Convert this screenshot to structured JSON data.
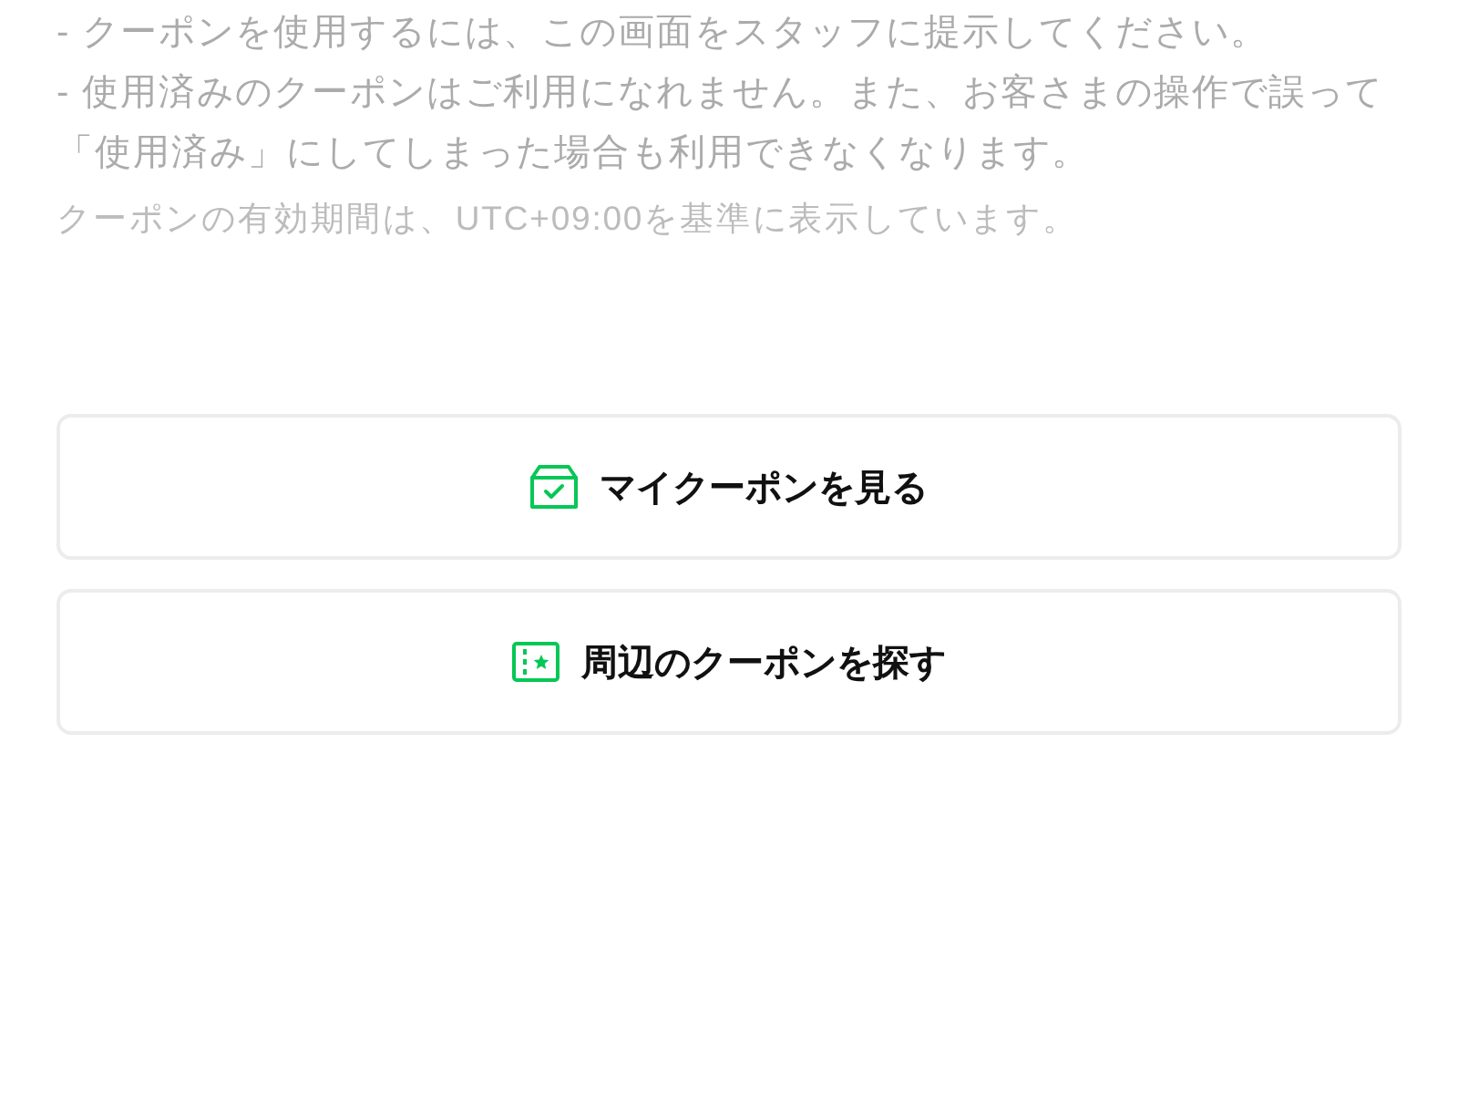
{
  "notes": [
    "- クーポンを使用するには、この画面をスタッフに提示してください。",
    "- 使用済みのクーポンはご利用になれません。また、お客さまの操作で誤って「使用済み」にしてしまった場合も利用できなくなります。"
  ],
  "timezone_note": "クーポンの有効期間は、UTC+09:00を基準に表示しています。",
  "buttons": [
    {
      "label": "マイクーポンを見る",
      "kind": "my_coupons"
    },
    {
      "label": "周辺のクーポンを探す",
      "kind": "nearby"
    }
  ]
}
